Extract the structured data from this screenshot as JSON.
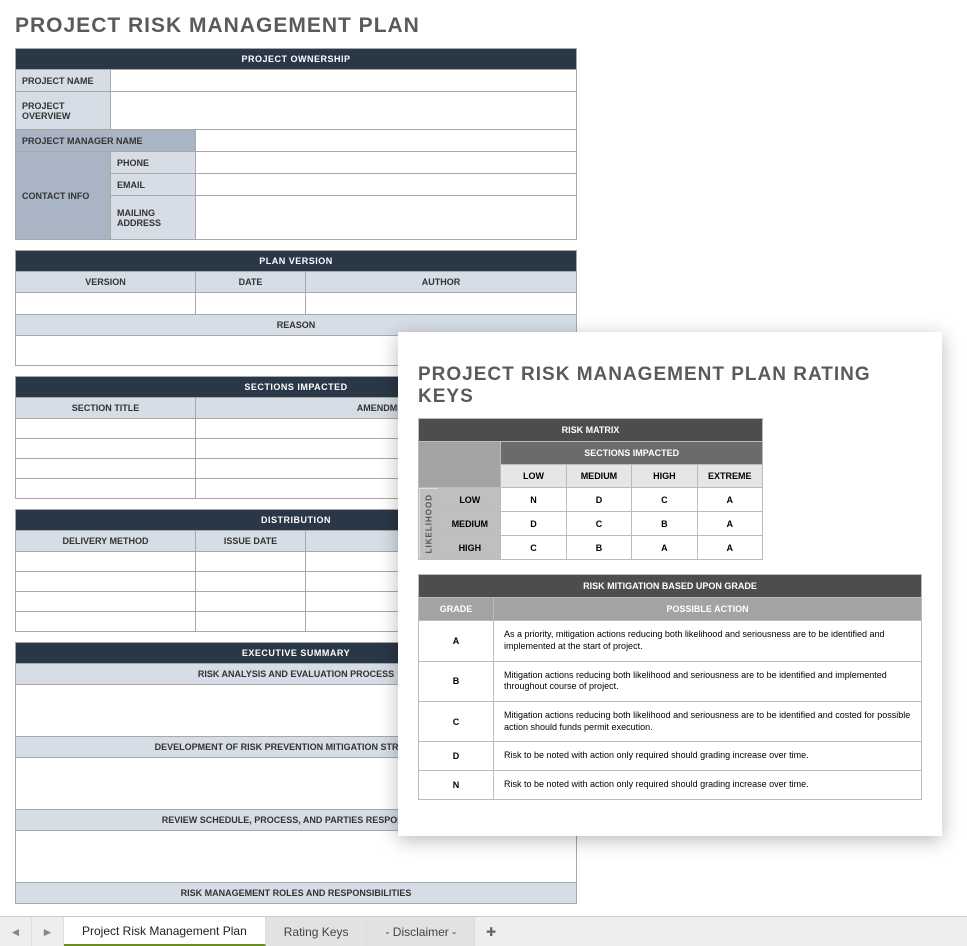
{
  "title": "PROJECT RISK MANAGEMENT PLAN",
  "ownership": {
    "header": "PROJECT OWNERSHIP",
    "project_name_label": "PROJECT NAME",
    "project_overview_label": "PROJECT OVERVIEW",
    "pm_name_label": "PROJECT MANAGER NAME",
    "contact_info_label": "CONTACT INFO",
    "phone_label": "PHONE",
    "email_label": "EMAIL",
    "mailing_label": "MAILING ADDRESS"
  },
  "version": {
    "header": "PLAN VERSION",
    "col_version": "VERSION",
    "col_date": "DATE",
    "col_author": "AUTHOR",
    "reason_label": "REASON"
  },
  "sections": {
    "header": "SECTIONS IMPACTED",
    "col_title": "SECTION TITLE",
    "col_amendment": "AMENDMENT"
  },
  "distribution": {
    "header": "DISTRIBUTION",
    "col_delivery": "DELIVERY METHOD",
    "col_issue": "ISSUE DATE"
  },
  "exec": {
    "header": "EXECUTIVE SUMMARY",
    "r1": "RISK ANALYSIS AND EVALUATION PROCESS",
    "r2": "DEVELOPMENT OF RISK PREVENTION MITIGATION STRATEGIES",
    "r3": "REVIEW SCHEDULE, PROCESS, AND PARTIES RESPONSIBLE",
    "r4": "RISK MANAGEMENT ROLES AND RESPONSIBILITIES"
  },
  "overlay": {
    "title": "PROJECT RISK MANAGEMENT PLAN RATING KEYS",
    "matrix": {
      "header": "RISK MATRIX",
      "impact_header": "SECTIONS IMPACTED",
      "likelihood_label": "LIKELIHOOD",
      "cols": [
        "LOW",
        "MEDIUM",
        "HIGH",
        "EXTREME"
      ],
      "rows": [
        "LOW",
        "MEDIUM",
        "HIGH"
      ],
      "cells": [
        [
          "N",
          "D",
          "C",
          "A"
        ],
        [
          "D",
          "C",
          "B",
          "A"
        ],
        [
          "C",
          "B",
          "A",
          "A"
        ]
      ]
    },
    "mitigation": {
      "header": "RISK MITIGATION BASED UPON GRADE",
      "col_grade": "GRADE",
      "col_action": "POSSIBLE ACTION",
      "rows": [
        {
          "grade": "A",
          "action": "As a priority, mitigation actions reducing both likelihood and seriousness are to be identified and implemented at the start of project."
        },
        {
          "grade": "B",
          "action": "Mitigation actions reducing both likelihood and seriousness are to be identified and implemented throughout course of project."
        },
        {
          "grade": "C",
          "action": "Mitigation actions reducing both likelihood and seriousness are to be identified and costed for possible action should funds permit execution."
        },
        {
          "grade": "D",
          "action": "Risk to be noted with action only required should grading increase over time."
        },
        {
          "grade": "N",
          "action": "Risk to be noted with action only required should grading increase over time."
        }
      ]
    }
  },
  "tabs": {
    "t1": "Project Risk Management Plan",
    "t2": "Rating Keys",
    "t3": "- Disclaimer -"
  }
}
